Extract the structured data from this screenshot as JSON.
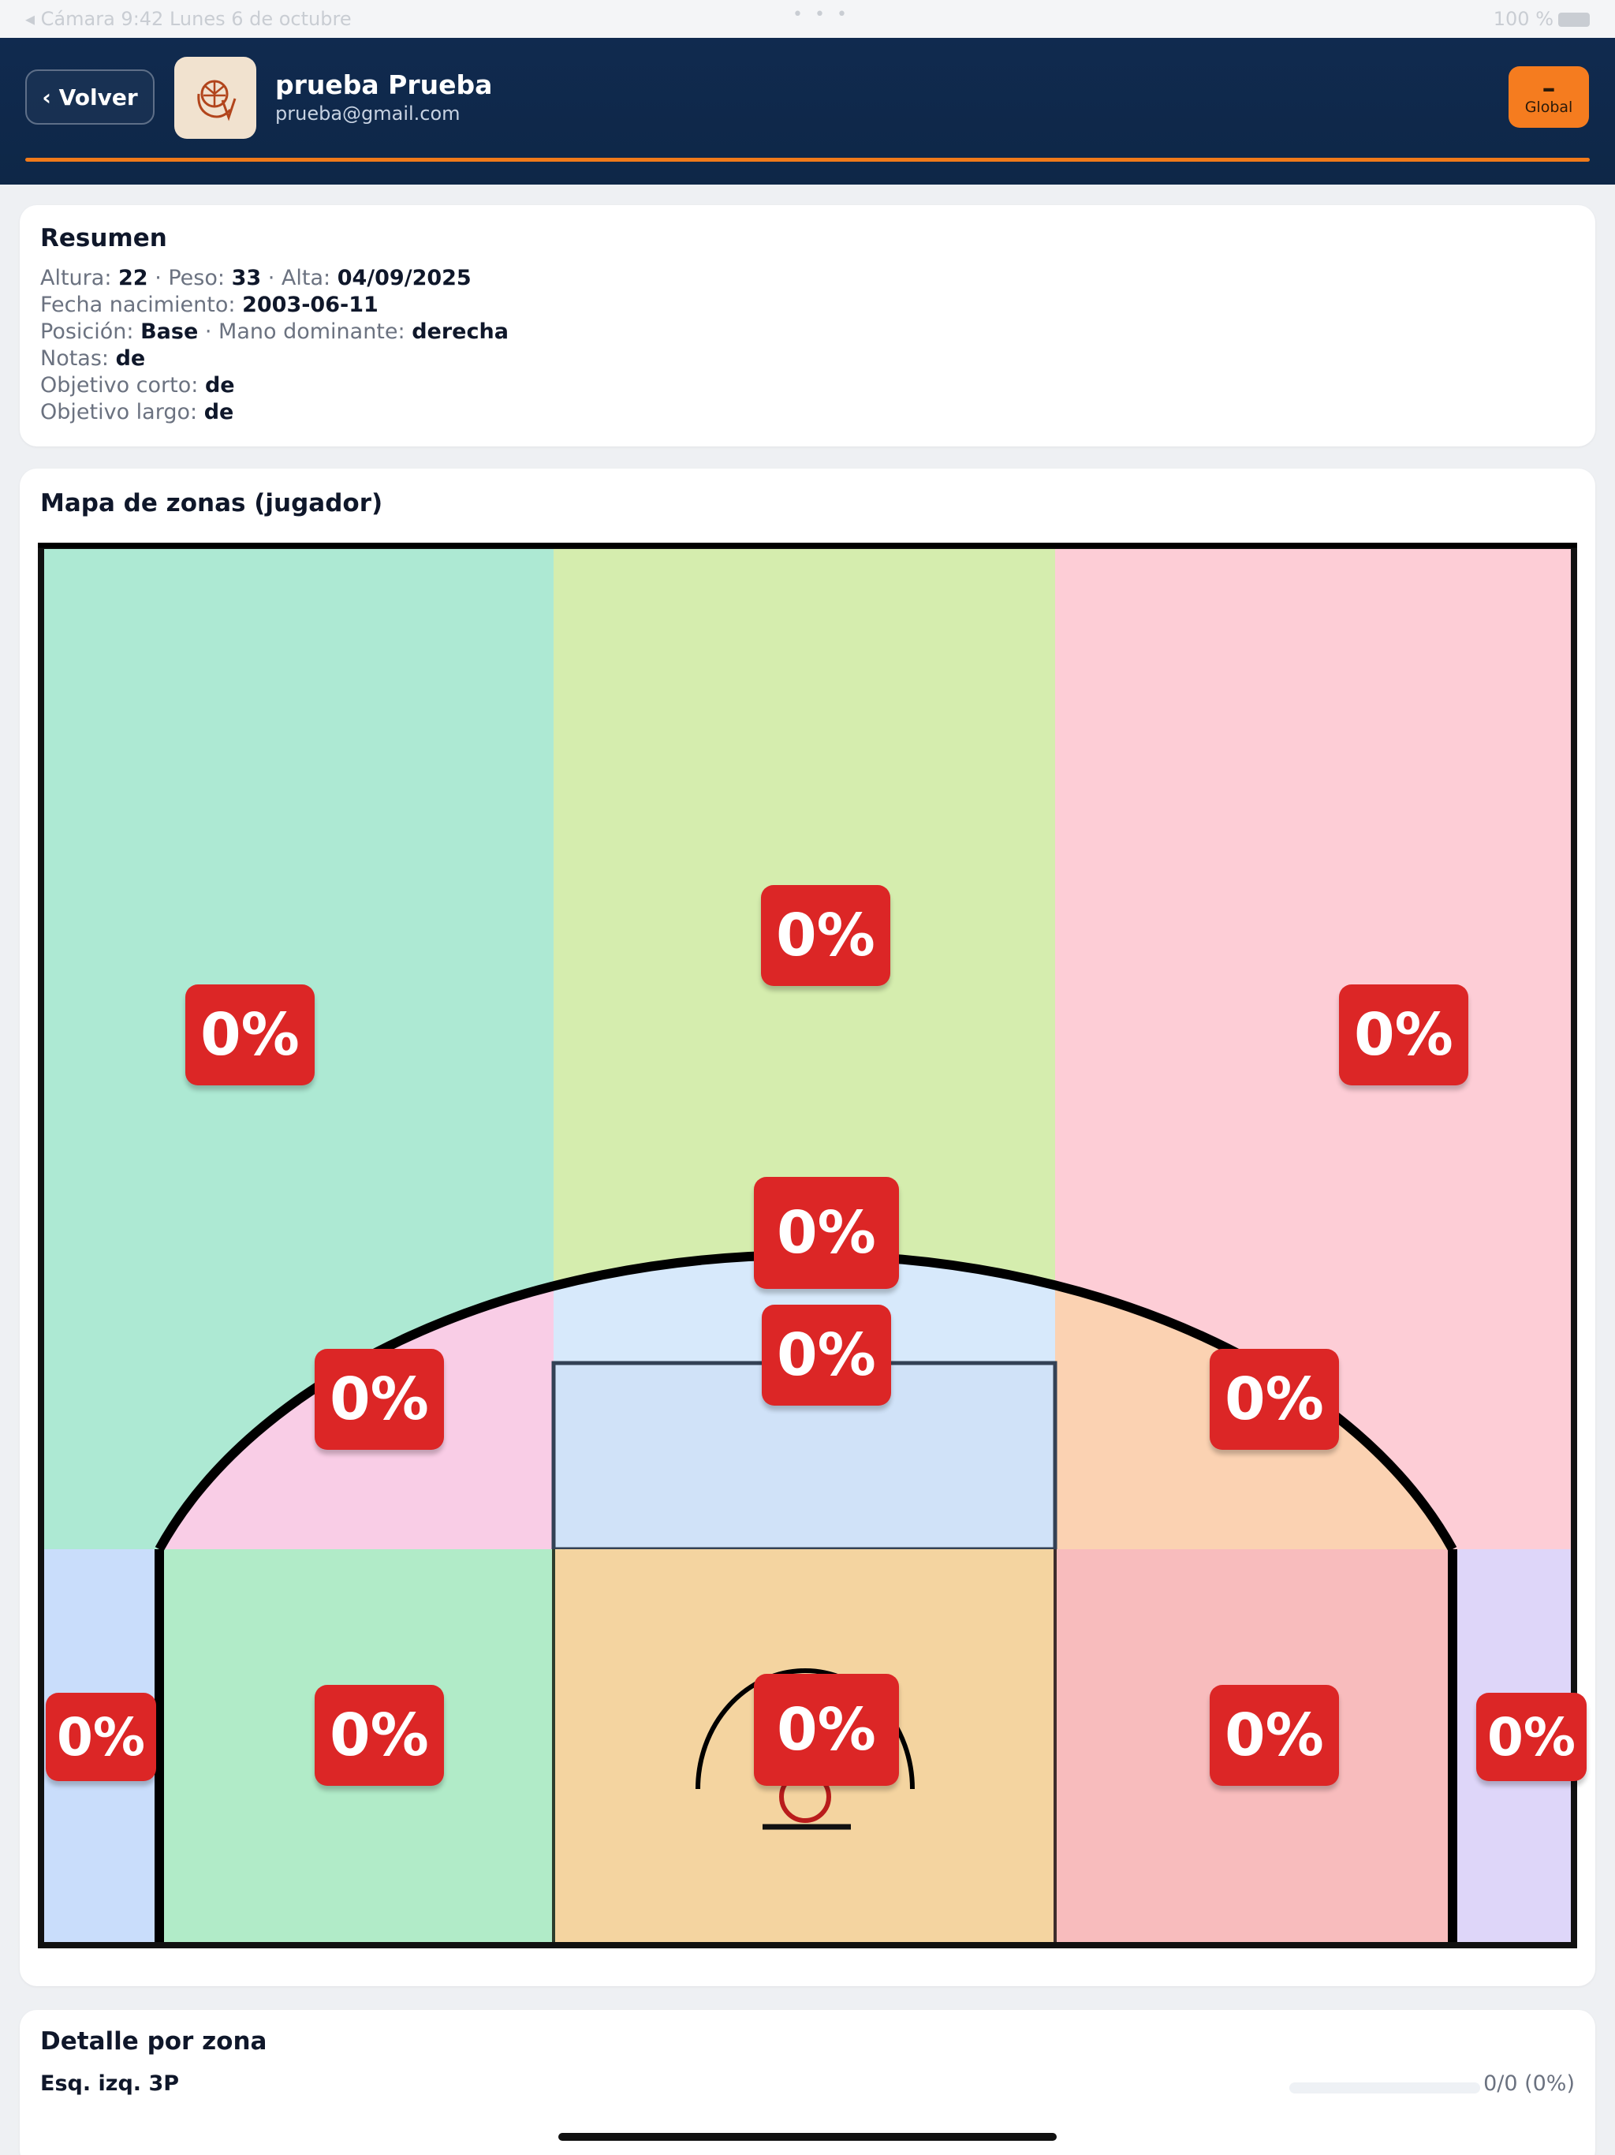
{
  "status_bar": {
    "left": "◂ Cámara   9:42   Lunes 6 de octubre",
    "dots": "• • •",
    "right": "100 %"
  },
  "header": {
    "back_label": "‹ Volver",
    "user_name": "prueba Prueba",
    "user_email": "prueba@gmail.com",
    "global_symbol": "–",
    "global_label": "Global",
    "accent_color": "#f57c1f",
    "background_color": "#102a4f"
  },
  "resumen": {
    "title": "Resumen",
    "altura_label": "Altura:",
    "altura": "22",
    "peso_label": "· Peso:",
    "peso": "33",
    "alta_label": "· Alta:",
    "alta": "04/09/2025",
    "fecha_label": "Fecha nacimiento:",
    "fecha": "2003-06-11",
    "posicion_label": "Posición:",
    "posicion": "Base",
    "mano_label": "· Mano dominante:",
    "mano": "derecha",
    "notas_label": "Notas:",
    "notas": "de",
    "obj_corto_label": "Objetivo corto:",
    "obj_corto": "de",
    "obj_largo_label": "Objetivo largo:",
    "obj_largo": "de"
  },
  "mapa": {
    "title": "Mapa de zonas (jugador)",
    "zones": [
      {
        "name": "deep-left",
        "value": "0%"
      },
      {
        "name": "deep-center",
        "value": "0%"
      },
      {
        "name": "deep-right",
        "value": "0%"
      },
      {
        "name": "top-key",
        "value": "0%"
      },
      {
        "name": "free-throw",
        "value": "0%"
      },
      {
        "name": "left-wing-mid",
        "value": "0%"
      },
      {
        "name": "right-wing-mid",
        "value": "0%"
      },
      {
        "name": "left-corner-3",
        "value": "0%"
      },
      {
        "name": "left-baseline-mid",
        "value": "0%"
      },
      {
        "name": "paint",
        "value": "0%"
      },
      {
        "name": "right-baseline-mid",
        "value": "0%"
      },
      {
        "name": "right-corner-3",
        "value": "0%"
      }
    ],
    "badge_color": "#dc2626"
  },
  "detalle": {
    "title": "Detalle por zona",
    "rows": [
      {
        "label": "Esq. izq. 3P",
        "value": "0/0 (0%)",
        "progress": 0
      }
    ]
  }
}
